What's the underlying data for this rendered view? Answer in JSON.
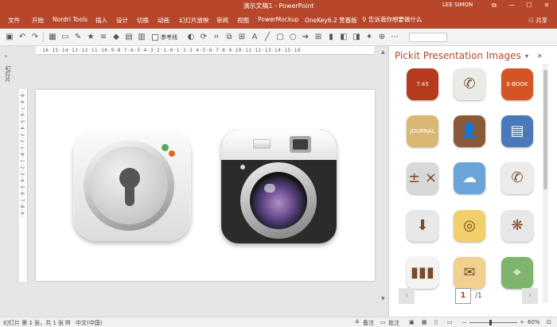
{
  "window": {
    "title": "演示文稿1 - PowerPoint",
    "user": "LEE SIMON",
    "restore_glyph": "⧉",
    "minimize_glyph": "—",
    "maximize_glyph": "☐",
    "close_glyph": "✕"
  },
  "ribbon": {
    "tabs": [
      "文件",
      "开始",
      "Nordri Tools",
      "插入",
      "设计",
      "切换",
      "动画",
      "幻灯片放映",
      "审阅",
      "视图",
      "PowerMockup",
      "OneKey6.2 营春版"
    ],
    "tell_me": "告诉我你想要做什么",
    "share": "共享"
  },
  "toolbar": {
    "checkbox_label": "参考线",
    "icons": [
      "save-icon",
      "undo-icon",
      "redo-icon",
      "star-icon",
      "align-icon",
      "shape-icon",
      "grid-icon",
      "color-icon"
    ]
  },
  "left_strip": {
    "collapse_arrow": "›",
    "label": "幻灯片"
  },
  "rulers": {
    "horizontal": "·16·15·14·13·12·11·10·9·8·7·6·5·4·3·2·1·0·1·2·3·4·5·6·7·8·9·10·11·12·13·14·15·16·",
    "vertical": "·9·8·7·6·5·4·3·2·1·0·1·2·3·4·5·6·7·8·9·"
  },
  "pane": {
    "title": "Pickit Presentation Images",
    "dropdown_glyph": "▾",
    "close_glyph": "✕",
    "icons": [
      {
        "name": "clock-app-icon",
        "text": "7:45",
        "color": "#b53a1e"
      },
      {
        "name": "phone-app-icon",
        "text": "✆",
        "color": "#e9ece6"
      },
      {
        "name": "ebook-app-icon",
        "text": "E-BOOK",
        "color": "#d55423"
      },
      {
        "name": "journal-app-icon",
        "text": "JOURNAL",
        "color": "#d9b872"
      },
      {
        "name": "contacts-app-icon",
        "text": "👤",
        "color": "#8a5a3a"
      },
      {
        "name": "notebook-app-icon",
        "text": "▤",
        "color": "#4a78b8"
      },
      {
        "name": "calculator-app-icon",
        "text": "± ×",
        "color": "#d8d8d8"
      },
      {
        "name": "weather-app-icon",
        "text": "☁",
        "color": "#6aa4d8"
      },
      {
        "name": "phone-call-app-icon",
        "text": "✆",
        "color": "#ececec"
      },
      {
        "name": "download-app-icon",
        "text": "⬇",
        "color": "#e8e8e8"
      },
      {
        "name": "target-map-app-icon",
        "text": "◎",
        "color": "#f1cf6a"
      },
      {
        "name": "film-reel-app-icon",
        "text": "❋",
        "color": "#e8e8e8"
      },
      {
        "name": "bar-chart-app-icon",
        "text": "▮▮▮",
        "color": "#f3f3f3"
      },
      {
        "name": "envelope-app-icon",
        "text": "✉",
        "color": "#f2d08f"
      },
      {
        "name": "map-pin-app-icon",
        "text": "⌖",
        "color": "#7eb46b"
      }
    ],
    "pager": {
      "prev_glyph": "‹",
      "next_glyph": "›",
      "current_page": "1",
      "total": "/1"
    }
  },
  "statusbar": {
    "slide_info": "幻灯片 第 1 张，共 1 张",
    "language": "中文(中国)",
    "notes": "备注",
    "comments": "批注",
    "zoom": "60%",
    "zoom_minus": "－",
    "zoom_plus": "+"
  }
}
